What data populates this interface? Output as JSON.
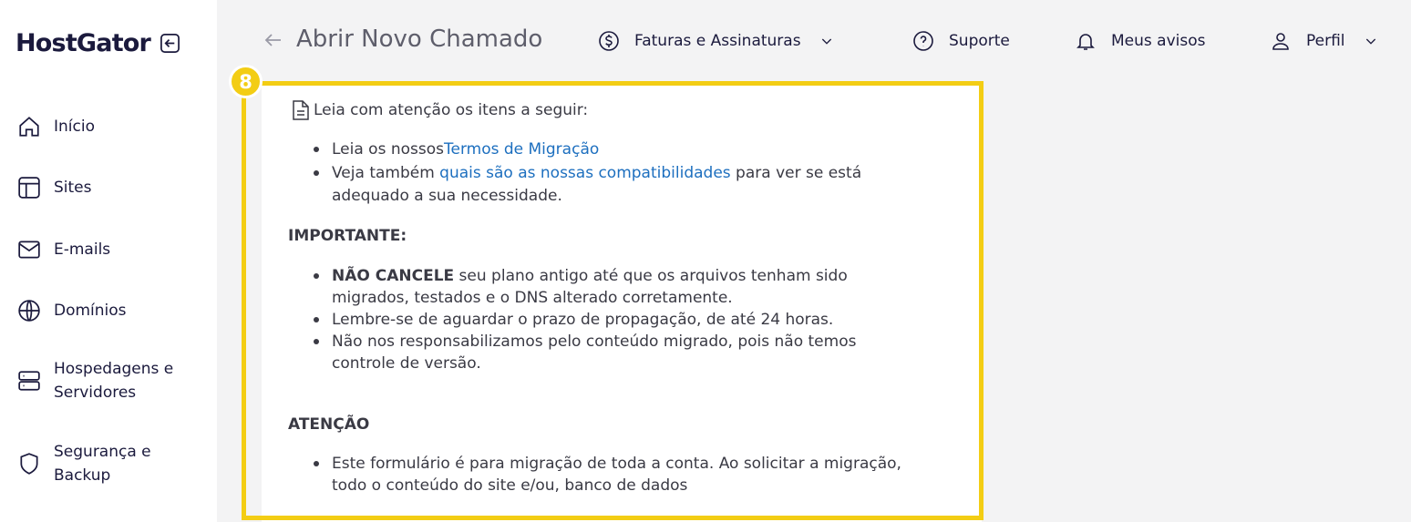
{
  "sidebar": {
    "logo": "HostGator",
    "items": [
      {
        "label": "Início",
        "icon": "home-icon"
      },
      {
        "label": "Sites",
        "icon": "layout-icon"
      },
      {
        "label": "E-mails",
        "icon": "mail-icon"
      },
      {
        "label": "Domínios",
        "icon": "globe-icon"
      },
      {
        "label_line1": "Hospedagens e",
        "label_line2": "Servidores",
        "icon": "server-icon"
      },
      {
        "label_line1": "Segurança e",
        "label_line2": "Backup",
        "icon": "shield-icon"
      }
    ]
  },
  "header": {
    "title": "Abrir Novo Chamado",
    "menu": [
      {
        "label": "Faturas e Assinaturas",
        "icon": "dollar-circle-icon"
      },
      {
        "label": "Suporte",
        "icon": "help-circle-icon"
      },
      {
        "label": "Meus avisos",
        "icon": "bell-icon"
      },
      {
        "label": "Perfil",
        "icon": "user-icon"
      }
    ]
  },
  "step_badge": "8",
  "content": {
    "intro": "Leia com atenção os itens a seguir:",
    "read_items": [
      {
        "text": "Leia os nossos",
        "link": "Termos de Migração"
      },
      {
        "text": "Veja também ",
        "link": "quais são as nossas compatibilidades",
        "after": " para ver se está",
        "line2": "adequado a sua necessidade."
      }
    ],
    "important_title": "IMPORTANTE:",
    "important_items": [
      {
        "strong": "NÃO CANCELE",
        "text": " seu plano antigo até que os arquivos tenham sido",
        "line2": "migrados, testados e o DNS alterado corretamente."
      },
      {
        "text": "Lembre-se de aguardar o prazo de propagação, de até 24 horas."
      },
      {
        "text": "Não nos responsabilizamos pelo conteúdo migrado, pois não temos",
        "line2": "controle de versão."
      }
    ],
    "attention_title": "ATENÇÃO",
    "attention_items": [
      {
        "text": "Este formulário é para migração de toda a conta. Ao solicitar a migração,",
        "line2": "todo o conteúdo do site e/ou, banco de dados"
      }
    ]
  },
  "colors": {
    "accent": "#f3cd14",
    "link": "#1d6fbf",
    "brand": "#1b1a3d"
  }
}
